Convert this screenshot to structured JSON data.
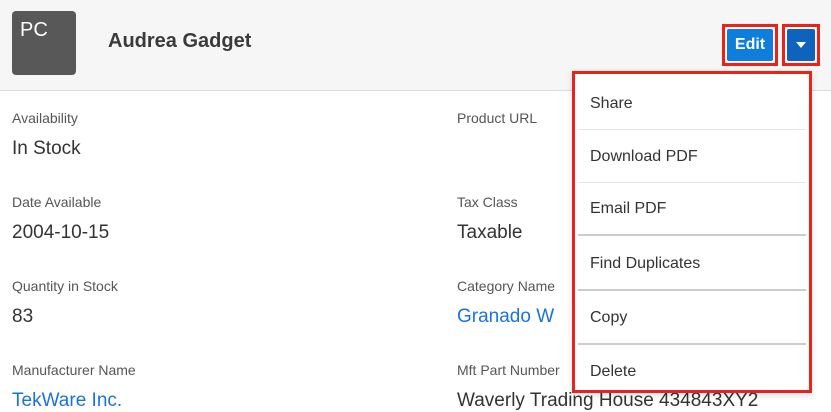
{
  "header": {
    "avatar_text": "PC",
    "title": "Audrea Gadget",
    "edit_label": "Edit"
  },
  "fields": {
    "availability": {
      "label": "Availability",
      "value": "In Stock"
    },
    "product_url": {
      "label": "Product URL",
      "value": ""
    },
    "date_available": {
      "label": "Date Available",
      "value": "2004-10-15"
    },
    "tax_class": {
      "label": "Tax Class",
      "value": "Taxable"
    },
    "quantity_in_stock": {
      "label": "Quantity in Stock",
      "value": "83"
    },
    "category_name": {
      "label": "Category Name",
      "value": "Granado W"
    },
    "manufacturer_name": {
      "label": "Manufacturer Name",
      "value": "TekWare Inc."
    },
    "mft_part_number": {
      "label": "Mft Part Number",
      "value": "Waverly Trading House 434843XY2"
    }
  },
  "menu": {
    "items": [
      "Share",
      "Download PDF",
      "Email PDF",
      "Find Duplicates",
      "Copy",
      "Delete"
    ]
  },
  "colors": {
    "accent": "#0e7ddb",
    "highlight": "#e8231a",
    "link": "#1a73d9"
  }
}
